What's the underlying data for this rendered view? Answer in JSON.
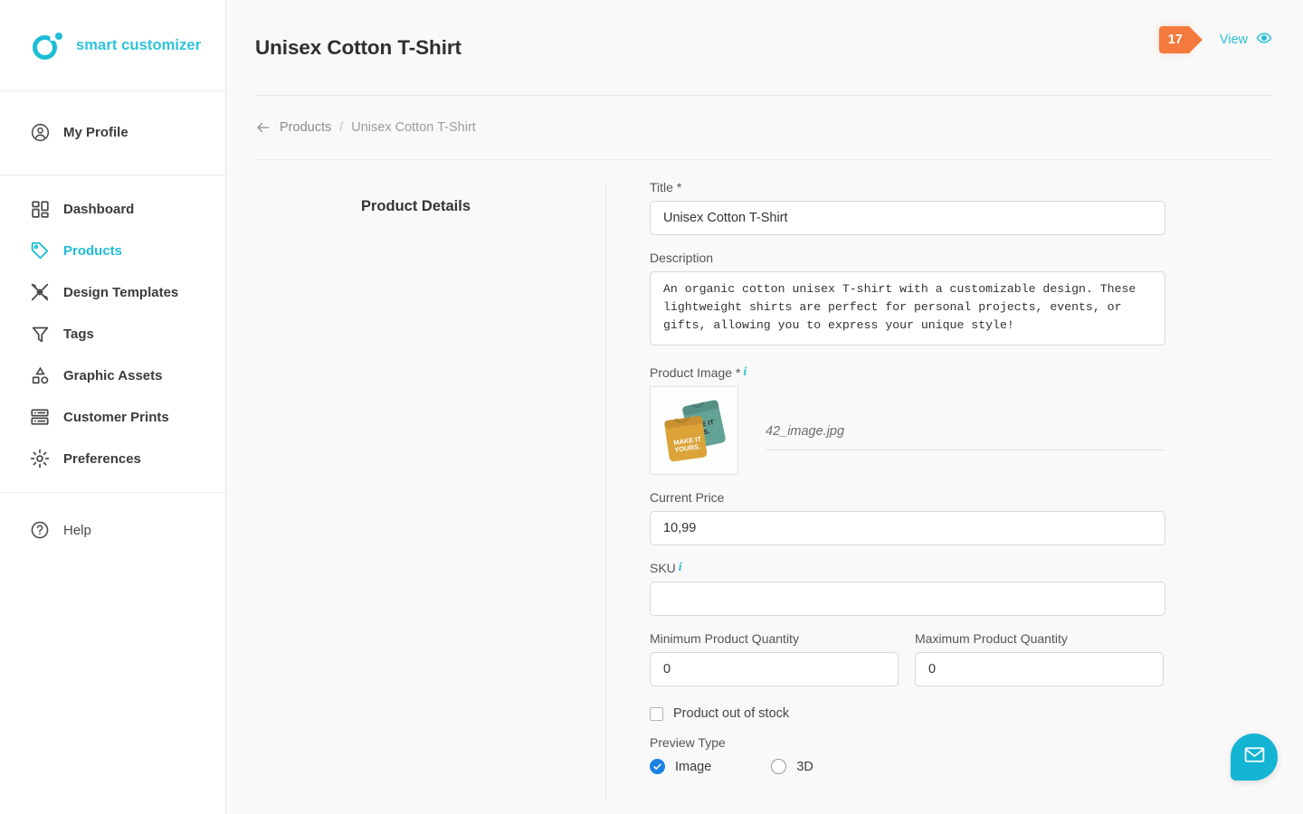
{
  "brand": {
    "name": "smart customizer"
  },
  "sidebar": {
    "profile": {
      "label": "My Profile",
      "icon": "user-circle-icon"
    },
    "items": [
      {
        "label": "Dashboard",
        "icon": "dashboard-icon",
        "active": false
      },
      {
        "label": "Products",
        "icon": "tag-icon",
        "active": true
      },
      {
        "label": "Design Templates",
        "icon": "design-templates-icon",
        "active": false
      },
      {
        "label": "Tags",
        "icon": "filter-icon",
        "active": false
      },
      {
        "label": "Graphic Assets",
        "icon": "shapes-icon",
        "active": false
      },
      {
        "label": "Customer Prints",
        "icon": "prints-icon",
        "active": false
      },
      {
        "label": "Preferences",
        "icon": "gear-icon",
        "active": false
      }
    ],
    "help": {
      "label": "Help",
      "icon": "help-circle-icon"
    }
  },
  "header": {
    "title": "Unisex Cotton T-Shirt",
    "badge_count": "17",
    "view_label": "View",
    "view_icon": "eye-icon",
    "badge_color": "#f4793c",
    "accent_color": "#2bbfd2"
  },
  "breadcrumb": {
    "back_icon": "arrow-left-icon",
    "parent": "Products",
    "separator": "/",
    "current": "Unisex Cotton T-Shirt"
  },
  "left_panel": {
    "section_title": "Product Details"
  },
  "form": {
    "title": {
      "label": "Title *",
      "value": "Unisex Cotton T-Shirt",
      "placeholder": ""
    },
    "description": {
      "label": "Description",
      "value": "An organic cotton unisex T-shirt with a customizable design. These lightweight shirts are perfect for personal projects, events, or gifts, allowing you to express your unique style!",
      "placeholder": ""
    },
    "product_image": {
      "label": "Product Image *",
      "info_icon": "info-icon",
      "file_name": "42_image.jpg",
      "thumb_alt": "folded-tshirts-make-it-yours"
    },
    "current_price": {
      "label": "Current Price",
      "value": "10,99",
      "placeholder": ""
    },
    "sku": {
      "label": "SKU",
      "value": "",
      "placeholder": "",
      "info_icon": "info-icon"
    },
    "min_quantity": {
      "label": "Minimum Product Quantity",
      "value": "0",
      "placeholder": ""
    },
    "max_quantity": {
      "label": "Maximum Product Quantity",
      "value": "0",
      "placeholder": ""
    },
    "out_of_stock": {
      "label": "Product out of stock",
      "checked": false
    },
    "preview_type": {
      "label": "Preview Type",
      "options": [
        {
          "label": "Image",
          "selected": true
        },
        {
          "label": "3D",
          "selected": false
        }
      ]
    }
  },
  "chat": {
    "icon": "envelope-icon",
    "color": "#13b4d4"
  }
}
